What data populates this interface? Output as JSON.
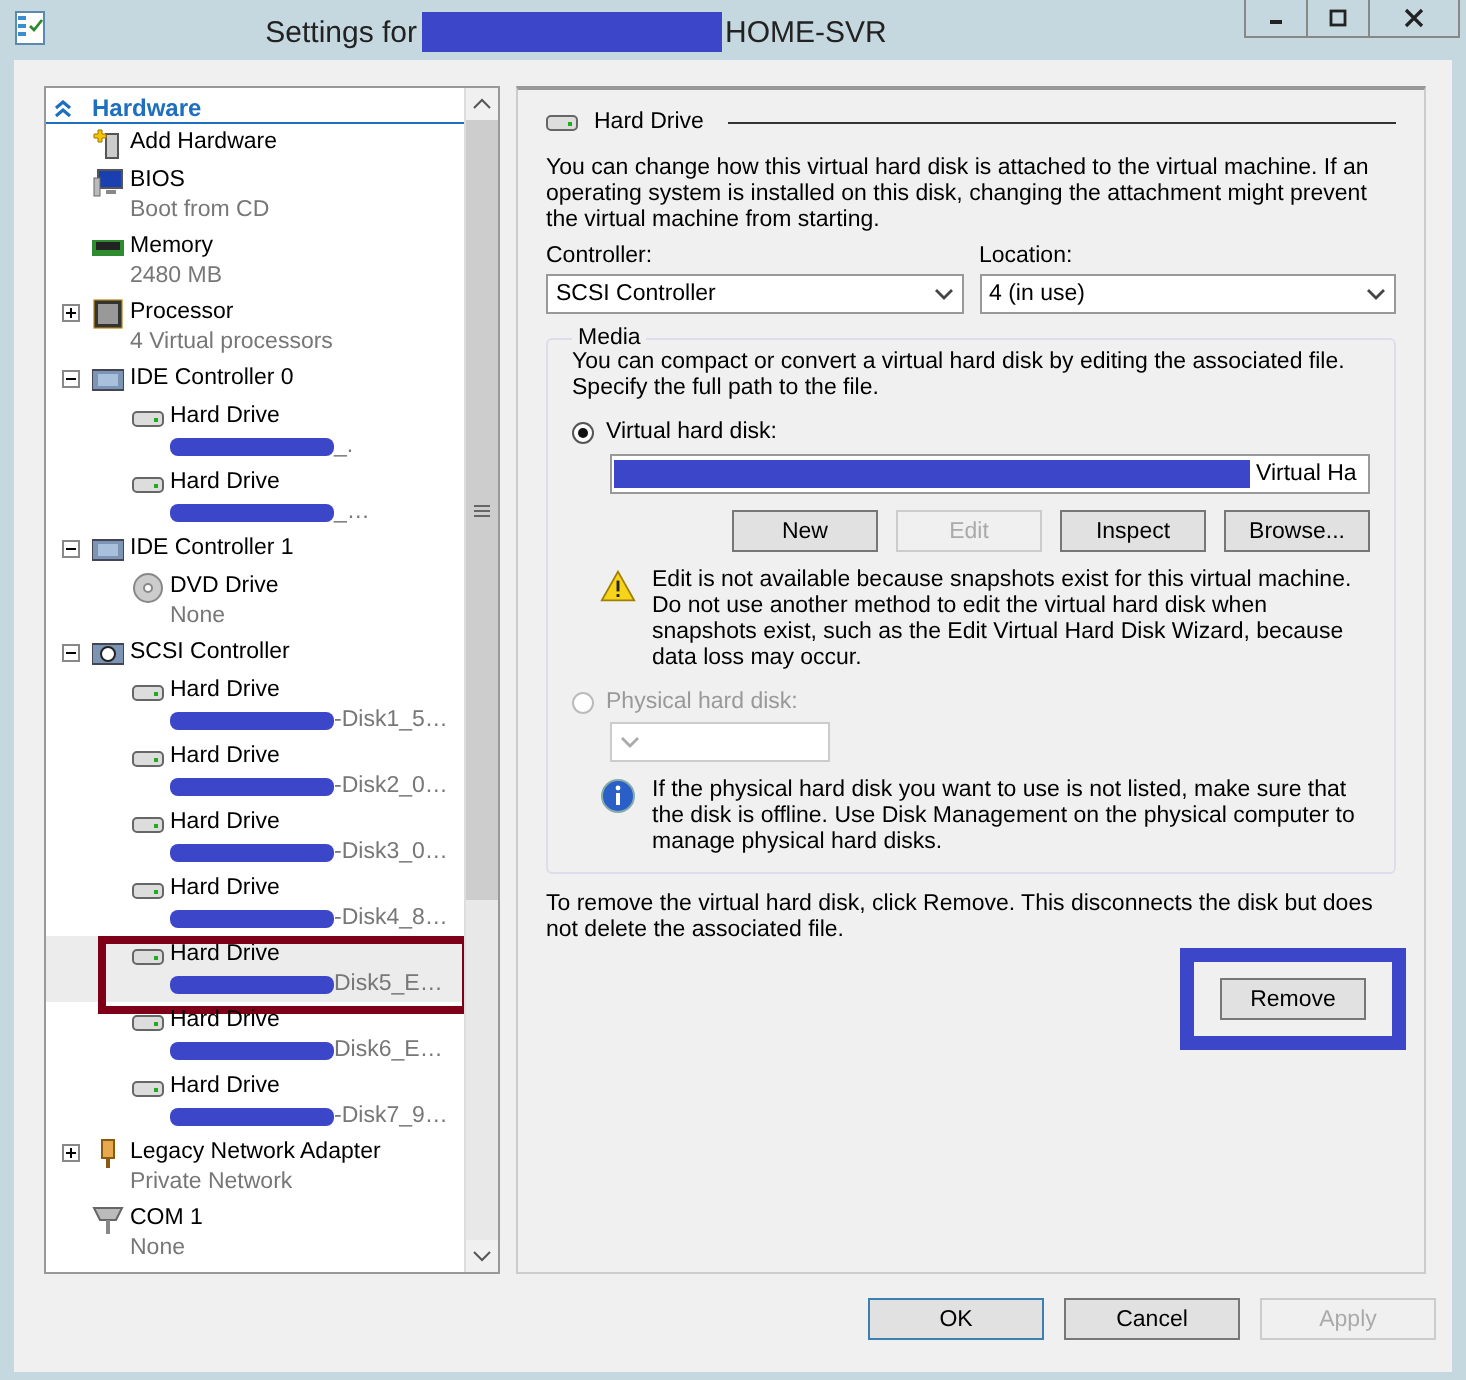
{
  "window": {
    "title_prefix": "Settings for",
    "title_redacted": true,
    "title_suffix": "HOME-SVR"
  },
  "tree": {
    "header": "Hardware",
    "expanded": true,
    "items": [
      {
        "kind": "add",
        "label": "Add Hardware",
        "selected": false
      },
      {
        "kind": "bios",
        "label": "BIOS",
        "detail": "Boot from CD",
        "selected": false
      },
      {
        "kind": "memory",
        "label": "Memory",
        "detail": "2480 MB",
        "selected": false
      },
      {
        "kind": "processor",
        "label": "Processor",
        "detail": "4 Virtual processors",
        "expanded": false,
        "selected": false
      },
      {
        "kind": "controller",
        "label": "IDE Controller 0",
        "expanded": true,
        "selected": false,
        "children": [
          {
            "kind": "drive",
            "label": "Hard Drive",
            "redacted": true,
            "detail": "_.",
            "selected": false
          },
          {
            "kind": "drive",
            "label": "Hard Drive",
            "redacted": true,
            "detail": "_…",
            "selected": false
          }
        ]
      },
      {
        "kind": "controller",
        "label": "IDE Controller 1",
        "expanded": true,
        "selected": false,
        "children": [
          {
            "kind": "dvd",
            "label": "DVD Drive",
            "detail": "None",
            "selected": false
          }
        ]
      },
      {
        "kind": "scsi",
        "label": "SCSI Controller",
        "expanded": true,
        "selected": false,
        "children": [
          {
            "kind": "drive",
            "label": "Hard Drive",
            "redacted": true,
            "detail": "-Disk1_5…",
            "selected": false
          },
          {
            "kind": "drive",
            "label": "Hard Drive",
            "redacted": true,
            "detail": "-Disk2_0…",
            "selected": false
          },
          {
            "kind": "drive",
            "label": "Hard Drive",
            "redacted": true,
            "detail": "-Disk3_0…",
            "selected": false
          },
          {
            "kind": "drive",
            "label": "Hard Drive",
            "redacted": true,
            "detail": "-Disk4_8…",
            "selected": false
          },
          {
            "kind": "drive",
            "label": "Hard Drive",
            "redacted": true,
            "detail": "Disk5_E…",
            "selected": true,
            "annotated": true
          },
          {
            "kind": "drive",
            "label": "Hard Drive",
            "redacted": true,
            "detail": "Disk6_E…",
            "selected": false
          },
          {
            "kind": "drive",
            "label": "Hard Drive",
            "redacted": true,
            "detail": "-Disk7_9…",
            "selected": false
          }
        ]
      },
      {
        "kind": "network",
        "label": "Legacy Network Adapter",
        "detail": "Private Network",
        "expanded": false,
        "selected": false
      },
      {
        "kind": "com",
        "label": "COM 1",
        "detail": "None",
        "selected": false
      }
    ]
  },
  "panel": {
    "heading": "Hard Drive",
    "intro": "You can change how this virtual hard disk is attached to the virtual machine. If an operating system is installed on this disk, changing the attachment might prevent the virtual machine from starting.",
    "controller": {
      "label": "Controller:",
      "value": "SCSI Controller"
    },
    "location": {
      "label": "Location:",
      "value": "4 (in use)"
    },
    "media": {
      "legend": "Media",
      "intro": "You can compact or convert a virtual hard disk by editing the associated file. Specify the full path to the file.",
      "options": [
        {
          "kind": "virtual",
          "label": "Virtual hard disk:",
          "selected": true,
          "disabled": false
        },
        {
          "kind": "physical",
          "label": "Physical hard disk:",
          "selected": false,
          "disabled": true
        }
      ],
      "path": {
        "redacted": true,
        "value": "Virtual Ha"
      },
      "buttons": [
        {
          "label": "New",
          "disabled": false
        },
        {
          "label": "Edit",
          "disabled": true
        },
        {
          "label": "Inspect",
          "disabled": false
        },
        {
          "label": "Browse...",
          "disabled": false
        }
      ],
      "warning": "Edit is not available because snapshots exist for this virtual machine. Do not use another method to edit the virtual hard disk when snapshots exist, such as the Edit Virtual Hard Disk Wizard, because data loss may occur.",
      "info": "If the physical hard disk you want to use is not listed, make sure that the disk is offline. Use Disk Management on the physical computer to manage physical hard disks."
    },
    "remove_text": "To remove the virtual hard disk, click Remove. This disconnects the disk but does not delete the associated file.",
    "remove": {
      "label": "Remove",
      "annotated": true
    }
  },
  "footer": [
    {
      "label": "OK",
      "default": true,
      "disabled": false
    },
    {
      "label": "Cancel",
      "default": false,
      "disabled": false
    },
    {
      "label": "Apply",
      "default": false,
      "disabled": true
    }
  ]
}
